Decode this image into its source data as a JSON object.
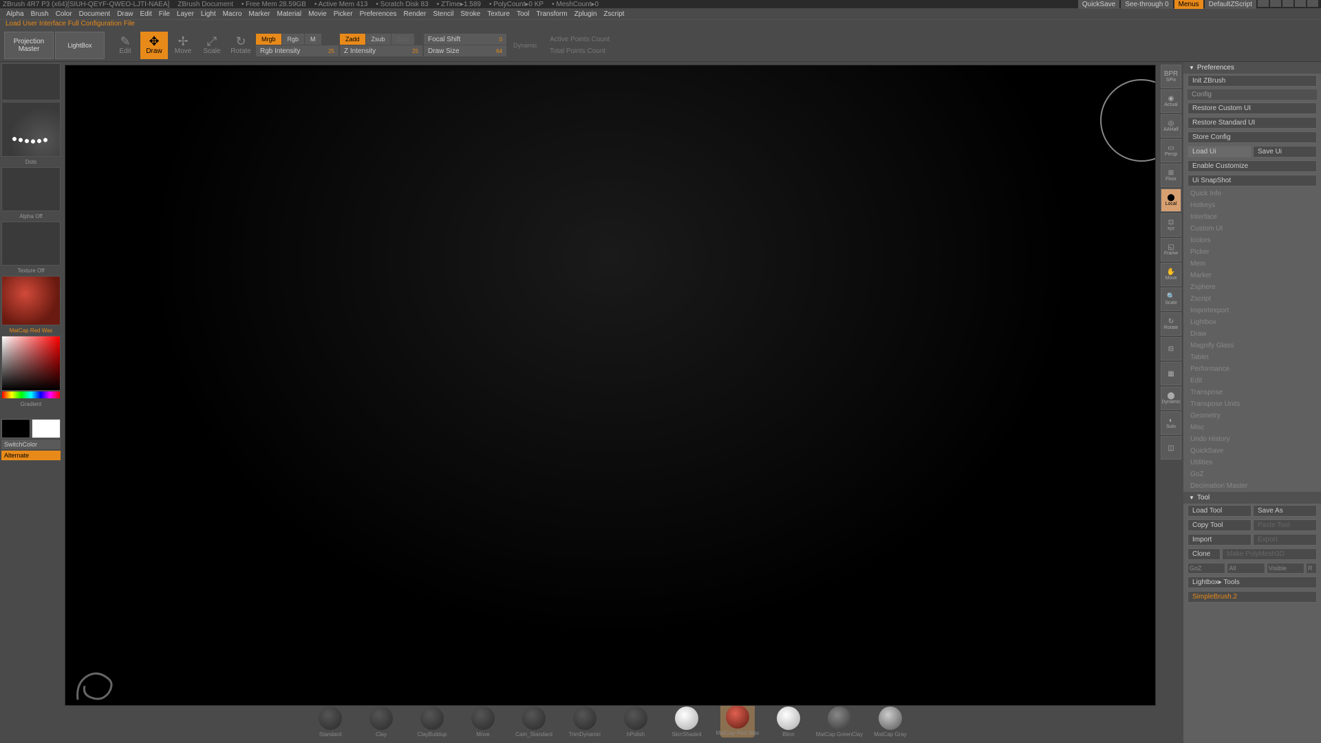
{
  "titlebar": {
    "app": "ZBrush 4R7 P3 (x64)[SIUH-QEYF-QWEO-LJTI-NAEA]",
    "doc": "ZBrush Document",
    "freemem": "• Free Mem 28.59GB",
    "activemem": "• Active Mem 413",
    "scratch": "• Scratch Disk 83",
    "ztime": "• ZTime▸1.589",
    "poly": "• PolyCount▸0 KP",
    "mesh": "• MeshCount▸0",
    "quicksave": "QuickSave",
    "seethrough": "See-through  0",
    "menus": "Menus",
    "defaultzscript": "DefaultZScript"
  },
  "menus": [
    "Alpha",
    "Brush",
    "Color",
    "Document",
    "Draw",
    "Edit",
    "File",
    "Layer",
    "Light",
    "Macro",
    "Marker",
    "Material",
    "Movie",
    "Picker",
    "Preferences",
    "Render",
    "Stencil",
    "Stroke",
    "Texture",
    "Tool",
    "Transform",
    "Zplugin",
    "Zscript"
  ],
  "status": "Load User Interface Full Configuration File",
  "toolbar": {
    "projection": "Projection\nMaster",
    "lightbox": "LightBox",
    "edit": "Edit",
    "draw": "Draw",
    "move": "Move",
    "scale": "Scale",
    "rotate": "Rotate",
    "mrgb": "Mrgb",
    "rgb": "Rgb",
    "m": "M",
    "rgbint": "Rgb Intensity",
    "rgbint_v": "25",
    "zadd": "Zadd",
    "zsub": "Zsub",
    "zcut": "Zcut",
    "zint": "Z Intensity",
    "zint_v": "25",
    "focal": "Focal Shift",
    "focal_v": "0",
    "drawsize": "Draw Size",
    "drawsize_v": "64",
    "dynamic": "Dynamic",
    "activepts": "Active Points Count",
    "totalpts": "Total Points Count"
  },
  "left": {
    "dots": "Dots",
    "alpha": "Alpha Off",
    "texture": "Texture Off",
    "material": "MatCap Red Wax",
    "gradient": "Gradient",
    "switchcolor": "SwitchColor",
    "alternate": "Alternate"
  },
  "matstrip": {
    "empties": [
      "Standard",
      "Clay",
      "ClayBuildup",
      "Move",
      "Cam_Standard",
      "TrimDynamic",
      "hPolish"
    ],
    "items": [
      {
        "label": "SkinShade4",
        "cls": "white"
      },
      {
        "label": "MatCap Red Wax",
        "cls": "red",
        "active": true
      },
      {
        "label": "Blinn",
        "cls": "white"
      },
      {
        "label": "MatCap GreenClay",
        "cls": "dark"
      },
      {
        "label": "MatCap Gray",
        "cls": "gray"
      }
    ]
  },
  "righticons": [
    {
      "l": "BPR",
      "sub": "SPix"
    },
    {
      "l": "◉",
      "sub": "Actual"
    },
    {
      "l": "◎",
      "sub": "AAHalf"
    },
    {
      "l": "▭",
      "sub": "Persp"
    },
    {
      "l": "⊞",
      "sub": "Floor"
    },
    {
      "l": "⬤",
      "sub": "Local",
      "active": true
    },
    {
      "l": "⊡",
      "sub": "xyz"
    },
    {
      "l": "◱",
      "sub": "Frame"
    },
    {
      "l": "✋",
      "sub": "Move"
    },
    {
      "l": "🔍",
      "sub": "Scale"
    },
    {
      "l": "↻",
      "sub": "Rotate"
    },
    {
      "l": "⊟",
      "sub": ""
    },
    {
      "l": "▦",
      "sub": ""
    },
    {
      "l": "⬤",
      "sub": "Dynamic"
    },
    {
      "l": "◐",
      "sub": "Solo"
    },
    {
      "l": "◫",
      "sub": ""
    }
  ],
  "prefs": {
    "title": "Preferences",
    "init": "Init ZBrush",
    "config": "Config",
    "restore_custom": "Restore Custom UI",
    "restore_standard": "Restore Standard UI",
    "store_config": "Store Config",
    "load_ui": "Load Ui",
    "save_ui": "Save Ui",
    "enable_customize": "Enable Customize",
    "ui_snapshot": "Ui SnapShot",
    "sections": [
      "Quick Info",
      "Hotkeys",
      "Interface",
      "Custom UI",
      "Icolors",
      "Picker",
      "Mem",
      "Marker",
      "Zsphere",
      "Zscript",
      "Importexport",
      "Lightbox",
      "Draw",
      "Magnify Glass",
      "Tablet",
      "Performance",
      "Edit",
      "Transpose",
      "Transpose Units",
      "Geometry",
      "Misc",
      "Undo History",
      "QuickSave",
      "Utilities",
      "GoZ",
      "Decimation Master"
    ]
  },
  "tool": {
    "title": "Tool",
    "load": "Load Tool",
    "save": "Save As",
    "copy": "Copy Tool",
    "paste": "Paste Tool",
    "import": "Import",
    "export": "Export",
    "clone": "Clone",
    "makepoly": "Make PolyMesh3D",
    "goz": "GoZ",
    "all": "All",
    "visible": "Visible",
    "r": "R",
    "lightbox_tools": "Lightbox▸ Tools",
    "simplebrush": "SimpleBrush.2"
  }
}
